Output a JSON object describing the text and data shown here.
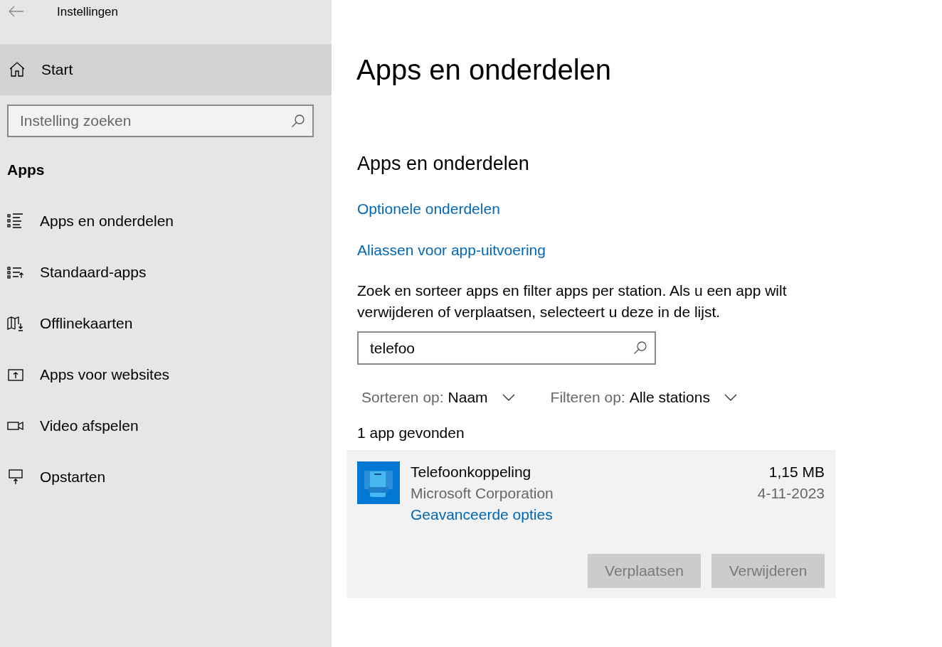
{
  "window": {
    "title": "Instellingen"
  },
  "sidebar": {
    "home": {
      "label": "Start",
      "highlighted": true
    },
    "search": {
      "placeholder": "Instelling zoeken"
    },
    "section": "Apps",
    "items": [
      {
        "label": "Apps en onderdelen",
        "selected": false
      },
      {
        "label": "Standaard-apps",
        "selected": false
      },
      {
        "label": "Offlinekaarten",
        "selected": false
      },
      {
        "label": "Apps voor websites",
        "selected": false
      },
      {
        "label": "Video afspelen",
        "selected": false
      },
      {
        "label": "Opstarten",
        "selected": false
      }
    ]
  },
  "main": {
    "title": "Apps en onderdelen",
    "subtitle": "Apps en onderdelen",
    "links": [
      "Optionele onderdelen",
      "Aliassen voor app-uitvoering"
    ],
    "description": "Zoek en sorteer apps en filter apps per station. Als u een app wilt verwijderen of verplaatsen, selecteert u deze in de lijst.",
    "search": {
      "value": "telefoo"
    },
    "sort": {
      "label": "Sorteren op:",
      "value": "Naam"
    },
    "filter": {
      "label": "Filteren op:",
      "value": "Alle stations"
    },
    "count": "1 app gevonden",
    "apps": [
      {
        "name": "Telefoonkoppeling",
        "publisher": "Microsoft Corporation",
        "link": "Geavanceerde opties",
        "size": "1,15 MB",
        "date": "4-11-2023",
        "expanded": true,
        "buttons": [
          {
            "label": "Verplaatsen",
            "disabled": true
          },
          {
            "label": "Verwijderen",
            "disabled": true
          }
        ]
      }
    ]
  }
}
